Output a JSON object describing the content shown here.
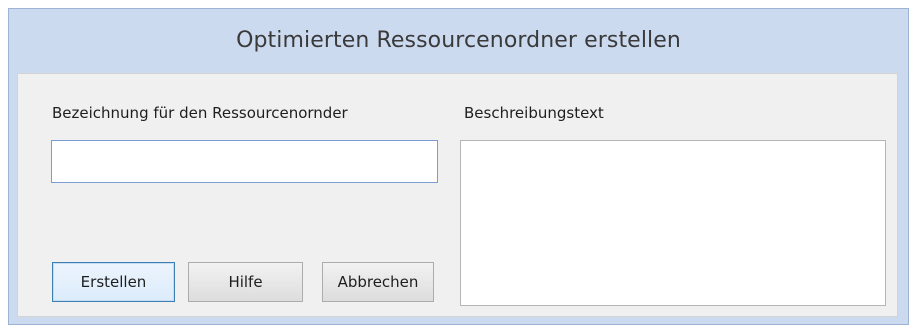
{
  "dialog": {
    "title": "Optimierten Ressourcenordner erstellen"
  },
  "form": {
    "name_label": "Bezeichnung für den Ressourcenornder",
    "name_value": "",
    "description_label": "Beschreibungstext",
    "description_value": ""
  },
  "buttons": {
    "create_label": "Erstellen",
    "help_label": "Hilfe",
    "cancel_label": "Abbrechen"
  },
  "colors": {
    "title_bar": "#ccdaf0",
    "client_area": "#f0f0f0",
    "default_button_border": "#3c7fb1"
  }
}
